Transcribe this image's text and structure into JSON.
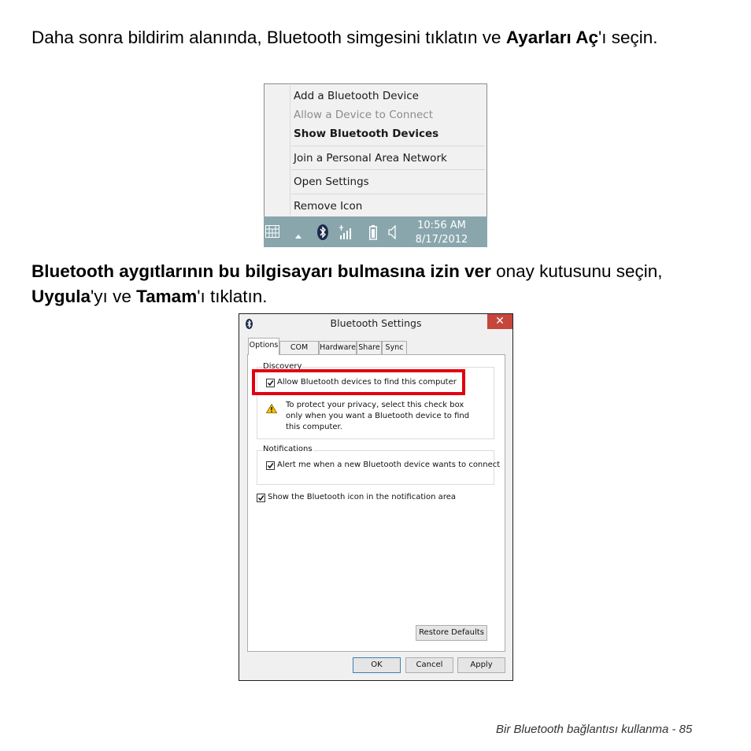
{
  "paragraph1": {
    "text_before": "Daha sonra bildirim alanında, Bluetooth simgesini tıklatın ve ",
    "bold": "Ayarları Aç",
    "text_after": "'ı seçin."
  },
  "context_menu": {
    "items": [
      {
        "label": "Add a Bluetooth Device"
      },
      {
        "label": "Allow a Device to Connect"
      },
      {
        "label": "Show Bluetooth Devices"
      },
      {
        "label": "Join a Personal Area Network"
      },
      {
        "label": "Open Settings"
      },
      {
        "label": "Remove Icon"
      }
    ]
  },
  "taskbar": {
    "time": "10:56 AM",
    "date": "8/17/2012",
    "icons": [
      "keyboard-icon",
      "show-hidden-icons-arrow",
      "bluetooth-icon",
      "network-signal-icon",
      "battery-icon",
      "volume-icon"
    ],
    "background_color": "#8aa6ad"
  },
  "paragraph2": {
    "bold1": "Bluetooth aygıtlarının bu bilgisayarı bulmasına izin ver",
    "text1": " onay kutusunu seçin, ",
    "bold2": "Uygula",
    "text2": "'yı ve ",
    "bold3": "Tamam",
    "text3": "'ı tıklatın."
  },
  "dialog": {
    "title": "Bluetooth Settings",
    "close_symbol": "✕",
    "tabs": [
      "Options",
      "COM Ports",
      "Hardware",
      "Share",
      "Sync"
    ],
    "discovery_legend": "Discovery",
    "allow_find_label": "Allow Bluetooth devices to find this computer",
    "allow_find_checked": true,
    "warning_text": "To protect your privacy, select this check box only when you want a Bluetooth device to find this computer.",
    "notifications_legend": "Notifications",
    "alert_label": "Alert me when a new Bluetooth device wants to connect",
    "alert_checked": true,
    "show_icon_label": "Show the Bluetooth icon in the notification area",
    "show_icon_checked": true,
    "restore_defaults_label": "Restore Defaults",
    "ok_label": "OK",
    "cancel_label": "Cancel",
    "apply_label": "Apply",
    "highlight_color": "#e1000f"
  },
  "footer": {
    "text": "Bir Bluetooth bağlantısı kullanma -  85"
  }
}
